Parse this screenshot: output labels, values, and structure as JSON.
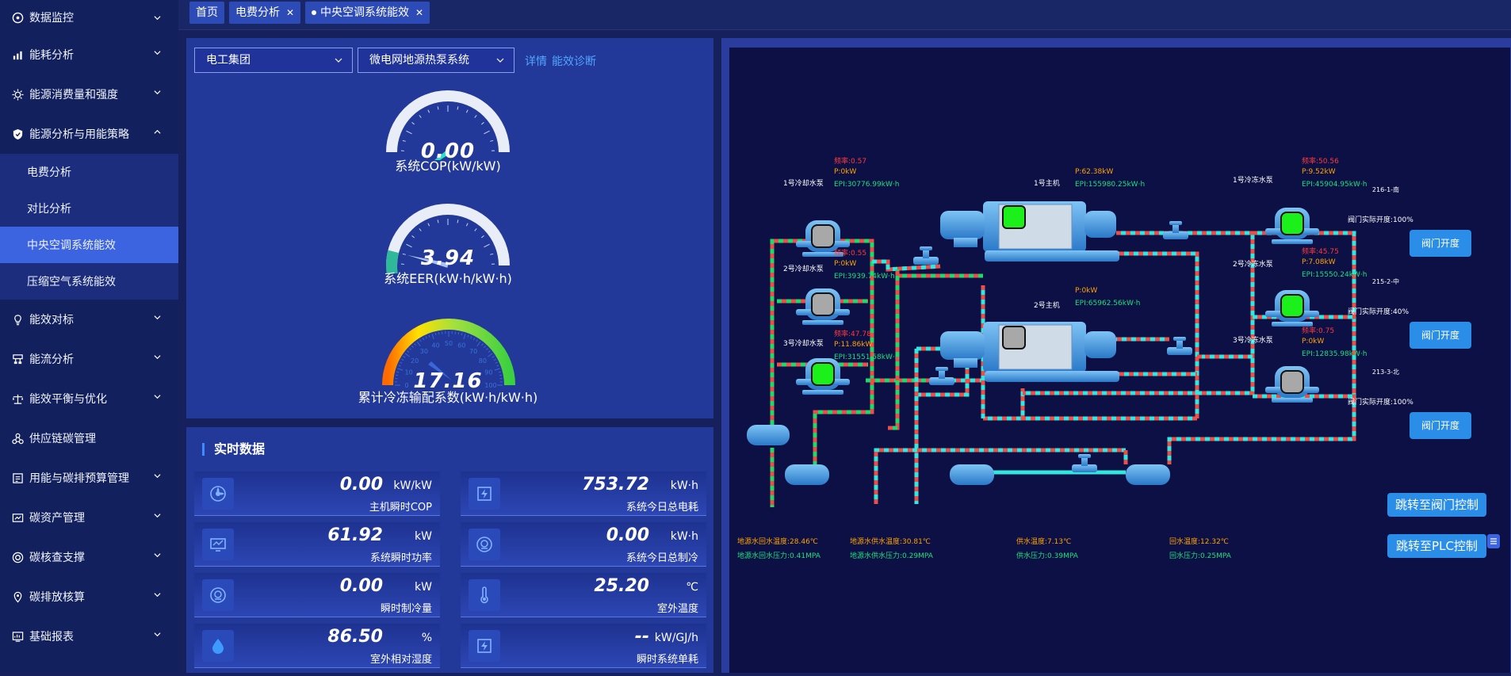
{
  "sidebar": {
    "items": [
      {
        "label": "数据监控"
      },
      {
        "label": "能耗分析"
      },
      {
        "label": "能源消费量和强度"
      },
      {
        "label": "能源分析与用能策略"
      },
      {
        "label": "能效对标"
      },
      {
        "label": "能流分析"
      },
      {
        "label": "能效平衡与优化"
      },
      {
        "label": "供应链碳管理"
      },
      {
        "label": "用能与碳排预算管理"
      },
      {
        "label": "碳资产管理"
      },
      {
        "label": "碳核查支撑"
      },
      {
        "label": "碳排放核算"
      },
      {
        "label": "基础报表"
      }
    ],
    "sub_items": [
      {
        "label": "电费分析"
      },
      {
        "label": "对比分析"
      },
      {
        "label": "中央空调系统能效"
      },
      {
        "label": "压缩空气系统能效"
      }
    ]
  },
  "tabs": [
    {
      "label": "首页"
    },
    {
      "label": "电费分析"
    },
    {
      "label": "中央空调系统能效"
    }
  ],
  "filters": {
    "group": "电工集团",
    "system": "微电网地源热泵系统",
    "link_detail": "详情",
    "link_diag": "能效诊断"
  },
  "gauges": [
    {
      "value": "0.00",
      "label": "系统COP(kW/kW)",
      "fraction": 0.0
    },
    {
      "value": "3.94",
      "label": "系统EER(kW·h/kW·h)",
      "fraction": 0.2
    },
    {
      "value": "17.16",
      "label": "累计冷冻输配系数(kW·h/kW·h)",
      "fraction": 0.17
    }
  ],
  "gauge3_ticks": [
    "0",
    "10",
    "20",
    "30",
    "40",
    "50",
    "60",
    "70",
    "80",
    "90",
    "100"
  ],
  "realtime": {
    "title": "实时数据",
    "cards": [
      {
        "value": "0.00",
        "unit": "kW/kW",
        "label": "主机瞬时COP",
        "icon": "fan-icon"
      },
      {
        "value": "753.72",
        "unit": "kW·h",
        "label": "系统今日总电耗",
        "icon": "power-meter-icon"
      },
      {
        "value": "61.92",
        "unit": "kW",
        "label": "系统瞬时功率",
        "icon": "monitor-icon"
      },
      {
        "value": "0.00",
        "unit": "kW·h",
        "label": "系统今日总制冷",
        "icon": "cooling-icon"
      },
      {
        "value": "0.00",
        "unit": "kW",
        "label": "瞬时制冷量",
        "icon": "cooling-icon"
      },
      {
        "value": "25.20",
        "unit": "℃",
        "label": "室外温度",
        "icon": "thermometer-icon"
      },
      {
        "value": "86.50",
        "unit": "%",
        "label": "室外相对湿度",
        "icon": "water-drop-icon"
      },
      {
        "value": "--",
        "unit": "kW/GJ/h",
        "label": "瞬时系统单耗",
        "icon": "power-meter-icon"
      }
    ]
  },
  "scada": {
    "labels": {
      "cw_pump1": "1号冷却水泵",
      "cw_pump2": "2号冷却水泵",
      "cw_pump3": "3号冷却水泵",
      "chiller1": "1号主机",
      "chiller2": "2号主机",
      "ch_pump1": "1号冷冻水泵",
      "ch_pump2": "2号冷冻水泵",
      "ch_pump3": "3号冷冻水泵"
    },
    "readings": {
      "cw1_freq": "频率:0.57",
      "cw1_p": "P:0kW",
      "cw1_epi": "EPI:30776.99kW·h",
      "cw2_freq": "频率:0.55",
      "cw2_p": "P:0kW",
      "cw2_epi": "EPI:3939.74kW·h",
      "cw3_freq": "频率:47.78",
      "cw3_p": "P:11.86kW",
      "cw3_epi": "EPI:31551.58kW·h",
      "ch1_p": "P:62.38kW",
      "ch1_epi": "EPI:155980.25kW·h",
      "ch2_p": "P:0kW",
      "ch2_epi": "EPI:65962.56kW·h",
      "cp1_freq": "频率:50.56",
      "cp1_p": "P:9.52kW",
      "cp1_epi": "EPI:45904.95kW·h",
      "cp2_freq": "频率:45.75",
      "cp2_p": "P:7.08kW",
      "cp2_epi": "EPI:15550.24kW·h",
      "cp3_freq": "频率:0.75",
      "cp3_p": "P:0kW",
      "cp3_epi": "EPI:12835.98kW·h"
    },
    "valves": [
      {
        "name": "216-1-南",
        "status": "阀门实际开度:100%",
        "button": "阀门开度"
      },
      {
        "name": "215-2-中",
        "status": "阀门实际开度:40%",
        "button": "阀门开度"
      },
      {
        "name": "213-3-北",
        "status": "阀门实际开度:100%",
        "button": "阀门开度"
      }
    ],
    "bottom": {
      "t1": "地源水回水温度:28.46℃",
      "p1": "地源水回水压力:0.41MPA",
      "t2": "地源水供水温度:30.81℃",
      "p2": "地源水供水压力:0.29MPA",
      "t3": "供水温度:7.13℃",
      "p3": "供水压力:0.39MPA",
      "t4": "回水温度:12.32℃",
      "p4": "回水压力:0.25MPA"
    },
    "jump_valve": "跳转至阀门控制",
    "jump_plc": "跳转至PLC控制"
  },
  "colors": {
    "pipe_red": "#e8504a",
    "pipe_cyan": "#30e8e0",
    "pipe_green": "#22d86a",
    "pump_on": "#1bf01b",
    "pump_off": "#a8a8a8",
    "accent": "#3c64e0"
  }
}
